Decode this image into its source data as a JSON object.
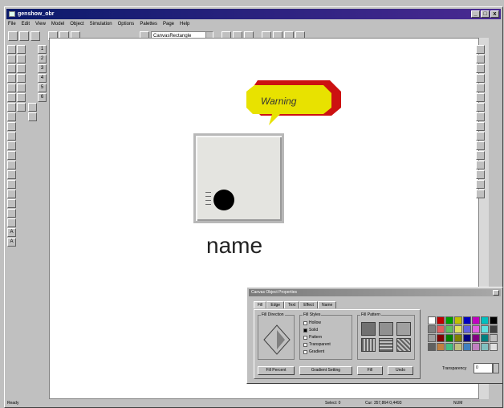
{
  "window": {
    "title": "genshow_obr",
    "btn_min": "_",
    "btn_max": "□",
    "btn_close": "x"
  },
  "menu": [
    "File",
    "Edit",
    "View",
    "Model",
    "Object",
    "Simulation",
    "Options",
    "Palettes",
    "Page",
    "Help"
  ],
  "toolbar": {
    "shape_combo": "CanvasRectangle"
  },
  "left_tools_numbers": [
    "1",
    "2",
    "3",
    "4",
    "5",
    "6"
  ],
  "canvas": {
    "warning_text": "Warning",
    "name_label": "name",
    "warning_fill": "#e8e200",
    "warning_edge": "#cc1111"
  },
  "dialog": {
    "title": "Canvas Object Properties",
    "tabs": [
      "Fill",
      "Edge",
      "Text",
      "Effect",
      "Name"
    ],
    "groups": {
      "direction": "Fill Direction",
      "styles": "Fill Styles",
      "pattern": "Fill Pattern"
    },
    "styles": [
      "Hollow",
      "Solid",
      "Pattern",
      "Transparent",
      "Gradient"
    ],
    "buttons": {
      "fill_percent": "Fill Percent",
      "gradient": "Gradient Setting",
      "fill": "Fill",
      "undo": "Undo"
    },
    "transparency_label": "Transparency",
    "transparency_value": "0",
    "palette_colors": [
      "#ffffff",
      "#c00000",
      "#00a000",
      "#c0c000",
      "#0000c0",
      "#c000c0",
      "#00c0c0",
      "#000000",
      "#808080",
      "#e06060",
      "#60c060",
      "#e0e060",
      "#6060e0",
      "#e060e0",
      "#60e0e0",
      "#404040",
      "#a0a0a0",
      "#800000",
      "#008000",
      "#808000",
      "#000080",
      "#800080",
      "#008080",
      "#c0c0c0",
      "#606060",
      "#c08040",
      "#40c080",
      "#c0c080",
      "#4080c0",
      "#c080c0",
      "#80c0c0",
      "#e0e0e0"
    ]
  },
  "status": {
    "left": "Ready",
    "mid1": "Select: 0",
    "mid2": "Cur: 357,864 0,4493",
    "right": "NUM"
  }
}
